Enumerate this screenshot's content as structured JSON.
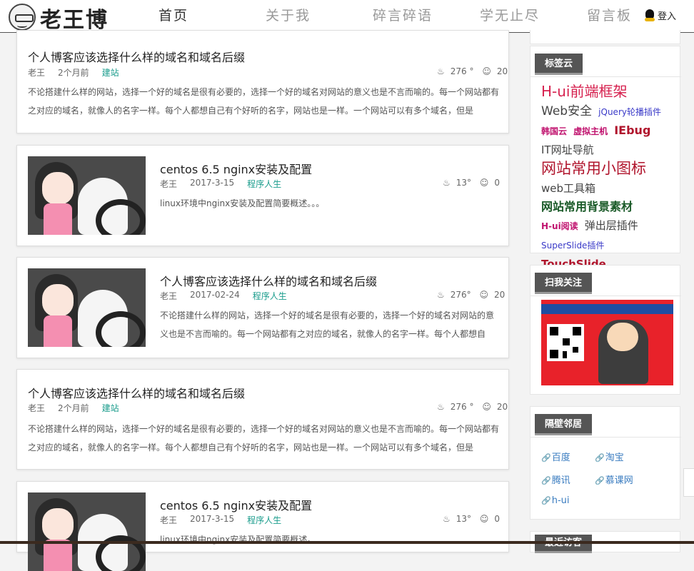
{
  "logo": {
    "text": "老王博客"
  },
  "nav": {
    "items": [
      {
        "label": "首页",
        "active": true
      },
      {
        "label": "关于我",
        "active": false
      },
      {
        "label": "碎言碎语",
        "active": false
      },
      {
        "label": "学无止尽",
        "active": false
      },
      {
        "label": "留言板",
        "active": false
      }
    ],
    "login": "登入"
  },
  "posts": [
    {
      "title": "个人博客应该选择什么样的域名和域名后缀",
      "author": "老王",
      "date": "2个月前",
      "category": "建站",
      "views": "276 °",
      "comments": "20",
      "excerpt": "不论搭建什么样的网站，选择一个好的域名是很有必要的，选择一个好的域名对网站的意义也是不言而喻的。每一个网站都有之对应的域名，就像人的名字一样。每个人都想自己有个好听的名字，网站也是一样。一个网站可以有多个域名，但是"
    },
    {
      "title": "centos 6.5 nginx安装及配置",
      "author": "老王",
      "date": "2017-3-15",
      "category": "程序人生",
      "views": "13°",
      "comments": "0",
      "excerpt": "linux环境中nginx安装及配置简要概述。。。"
    },
    {
      "title": "个人博客应该选择什么样的域名和域名后缀",
      "author": "老王",
      "date": "2017-02-24",
      "category": "程序人生",
      "views": "276°",
      "comments": "20",
      "excerpt": "不论搭建什么样的网站，选择一个好的域名是很有必要的，选择一个好的域名对网站的意义也是不言而喻的。每一个网站都有之对应的域名，就像人的名字一样。每个人都想自"
    },
    {
      "title": "个人博客应该选择什么样的域名和域名后缀",
      "author": "老王",
      "date": "2个月前",
      "category": "建站",
      "views": "276 °",
      "comments": "20",
      "excerpt": "不论搭建什么样的网站，选择一个好的域名是很有必要的，选择一个好的域名对网站的意义也是不言而喻的。每一个网站都有之对应的域名，就像人的名字一样。每个人都想自己有个好听的名字，网站也是一样。一个网站可以有多个域名，但是"
    },
    {
      "title": "centos 6.5 nginx安装及配置",
      "author": "老王",
      "date": "2017-3-15",
      "category": "程序人生",
      "views": "13°",
      "comments": "0",
      "excerpt": "linux环境中nginx安装及配置简要概述。"
    }
  ],
  "sidebar": {
    "tags_title": "标签云",
    "tags": [
      {
        "label": "H-ui前端框架",
        "color": "#d6204e"
      },
      {
        "label": "Web安全",
        "color": "#444444"
      },
      {
        "label": "jQuery轮播插件",
        "color": "#3a3ac8"
      },
      {
        "label": "韩国云",
        "color": "#c0126e"
      },
      {
        "label": "虚拟主机",
        "color": "#c0126e"
      },
      {
        "label": "IEbug",
        "color": "#b0142c"
      },
      {
        "label": "IT网址导航",
        "color": "#444444"
      },
      {
        "label": "网站常用小图标",
        "color": "#b0142c"
      },
      {
        "label": "web工具箱",
        "color": "#444444"
      },
      {
        "label": "网站常用背景素材",
        "color": "#1a5a28"
      },
      {
        "label": "H-ui阅读",
        "color": "#c0126e"
      },
      {
        "label": "弹出层插件",
        "color": "#444444"
      },
      {
        "label": "SuperSlide插件",
        "color": "#3a3ac8"
      },
      {
        "label": "TouchSlide",
        "color": "#b0142c"
      }
    ],
    "qr_title": "扫我关注",
    "links_title": "隔壁邻居",
    "links": [
      "百度",
      "淘宝",
      "腾讯",
      "慕课网",
      "h-ui"
    ],
    "next_title": "最近访客"
  }
}
